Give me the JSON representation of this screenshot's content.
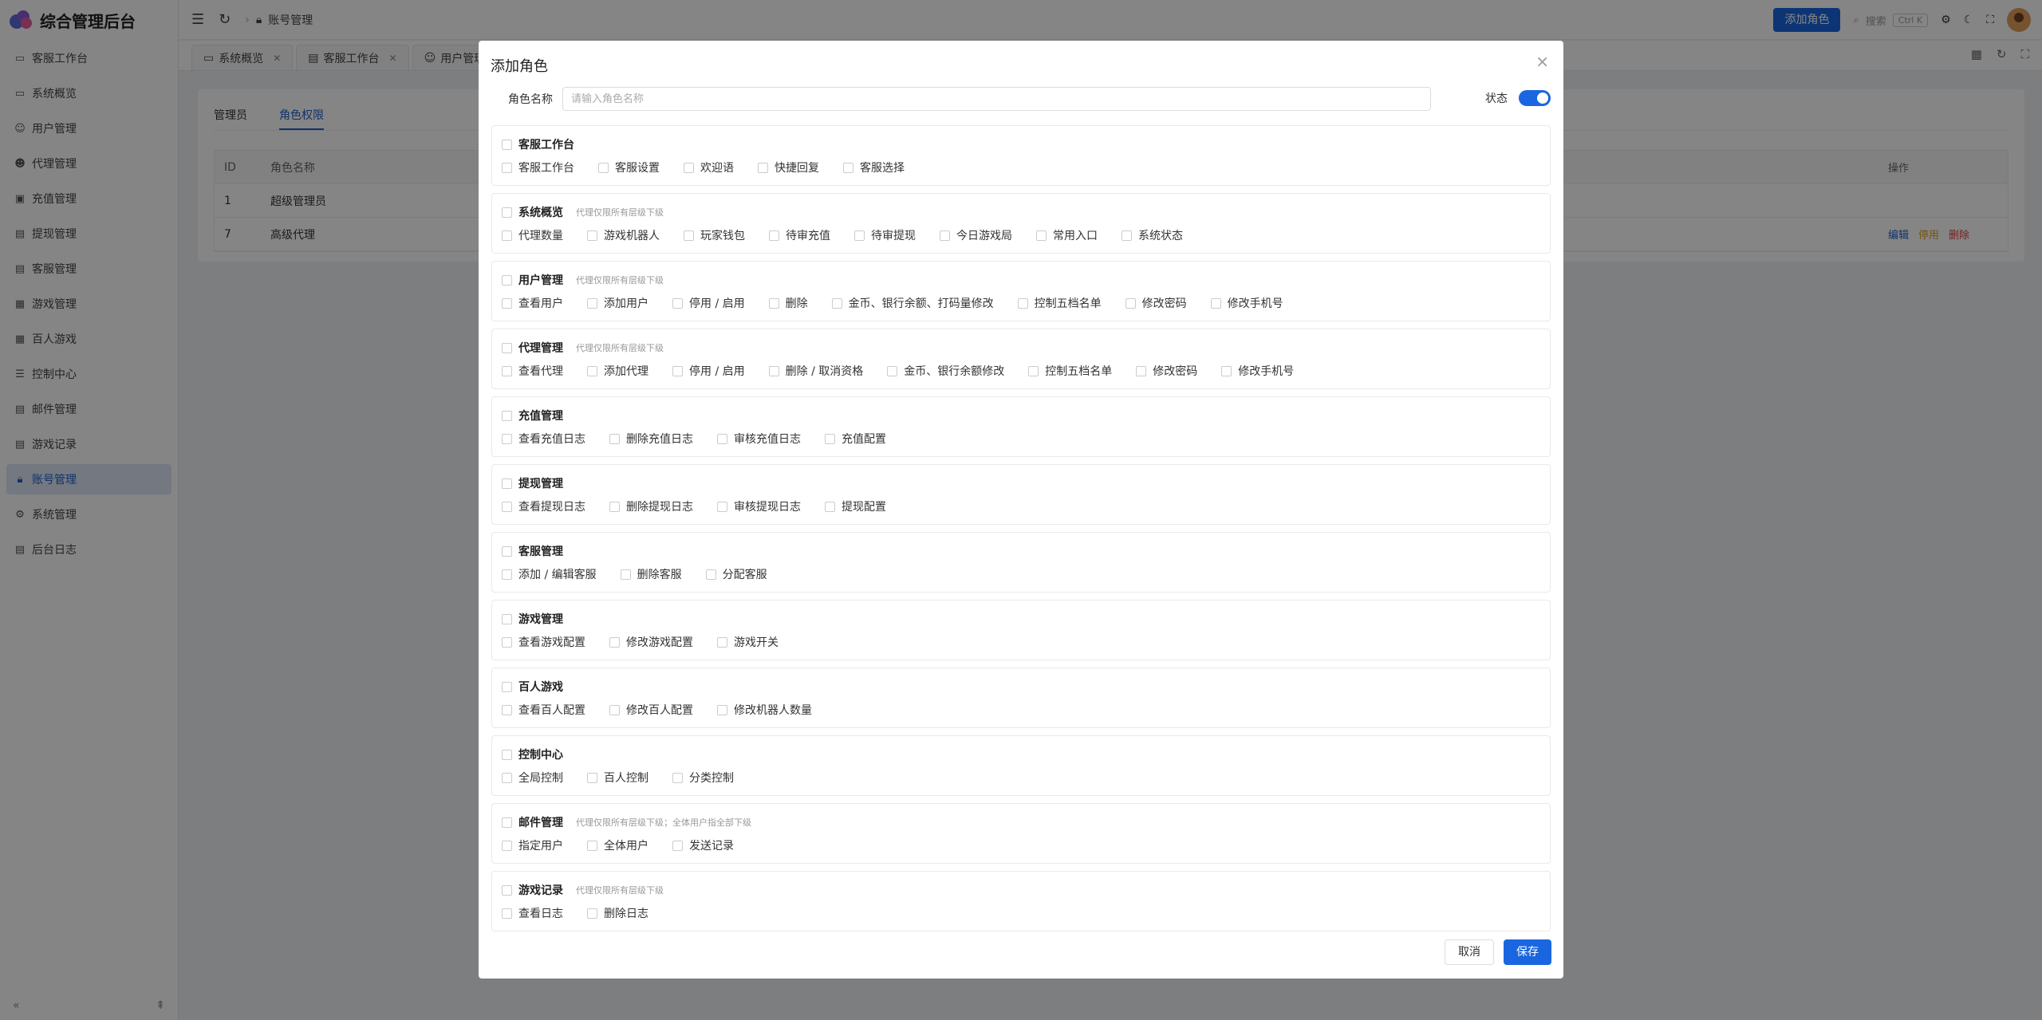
{
  "app": {
    "title": "综合管理后台"
  },
  "sidebar": {
    "items": [
      {
        "label": "客服工作台",
        "icon": "monitor-icon"
      },
      {
        "label": "系统概览",
        "icon": "monitor-icon"
      },
      {
        "label": "用户管理",
        "icon": "user-icon"
      },
      {
        "label": "代理管理",
        "icon": "user-solid-icon"
      },
      {
        "label": "充值管理",
        "icon": "wallet-icon"
      },
      {
        "label": "提现管理",
        "icon": "card-icon"
      },
      {
        "label": "客服管理",
        "icon": "document-icon"
      },
      {
        "label": "游戏管理",
        "icon": "grid-icon"
      },
      {
        "label": "百人游戏",
        "icon": "grid-icon"
      },
      {
        "label": "控制中心",
        "icon": "sliders-icon"
      },
      {
        "label": "邮件管理",
        "icon": "document-icon"
      },
      {
        "label": "游戏记录",
        "icon": "document-icon"
      },
      {
        "label": "账号管理",
        "icon": "lock-icon",
        "active": true
      },
      {
        "label": "系统管理",
        "icon": "gear-icon"
      },
      {
        "label": "后台日志",
        "icon": "document-icon"
      }
    ]
  },
  "topbar": {
    "breadcrumb": "账号管理",
    "add_role": "添加角色",
    "search_label": "搜索",
    "search_shortcut": "Ctrl K"
  },
  "tabs": [
    {
      "label": "系统概览"
    },
    {
      "label": "客服工作台"
    },
    {
      "label": "用户管理"
    }
  ],
  "page": {
    "subtabs": [
      "管理员",
      "角色权限"
    ],
    "table": {
      "headers": {
        "id": "ID",
        "name": "角色名称",
        "op": "操作"
      },
      "rows": [
        {
          "id": "1",
          "name": "超级管理员"
        },
        {
          "id": "7",
          "name": "高级代理"
        }
      ],
      "ops": {
        "edit": "编辑",
        "disable": "停用",
        "delete": "删除"
      }
    }
  },
  "modal": {
    "title": "添加角色",
    "role_label": "角色名称",
    "role_placeholder": "请输入角色名称",
    "status_label": "状态",
    "cancel": "取消",
    "save": "保存",
    "groups": [
      {
        "title": "客服工作台",
        "note": "",
        "items": [
          "客服工作台",
          "客服设置",
          "欢迎语",
          "快捷回复",
          "客服选择"
        ]
      },
      {
        "title": "系统概览",
        "note": "代理仅限所有层级下级",
        "items": [
          "代理数量",
          "游戏机器人",
          "玩家钱包",
          "待审充值",
          "待审提现",
          "今日游戏局",
          "常用入口",
          "系统状态"
        ]
      },
      {
        "title": "用户管理",
        "note": "代理仅限所有层级下级",
        "items": [
          "查看用户",
          "添加用户",
          "停用 / 启用",
          "删除",
          "金币、银行余额、打码量修改",
          "控制五档名单",
          "修改密码",
          "修改手机号"
        ]
      },
      {
        "title": "代理管理",
        "note": "代理仅限所有层级下级",
        "items": [
          "查看代理",
          "添加代理",
          "停用 / 启用",
          "删除 / 取消资格",
          "金币、银行余额修改",
          "控制五档名单",
          "修改密码",
          "修改手机号"
        ]
      },
      {
        "title": "充值管理",
        "note": "",
        "items": [
          "查看充值日志",
          "删除充值日志",
          "审核充值日志",
          "充值配置"
        ]
      },
      {
        "title": "提现管理",
        "note": "",
        "items": [
          "查看提现日志",
          "删除提现日志",
          "审核提现日志",
          "提现配置"
        ]
      },
      {
        "title": "客服管理",
        "note": "",
        "items": [
          "添加 / 编辑客服",
          "删除客服",
          "分配客服"
        ]
      },
      {
        "title": "游戏管理",
        "note": "",
        "items": [
          "查看游戏配置",
          "修改游戏配置",
          "游戏开关"
        ]
      },
      {
        "title": "百人游戏",
        "note": "",
        "items": [
          "查看百人配置",
          "修改百人配置",
          "修改机器人数量"
        ]
      },
      {
        "title": "控制中心",
        "note": "",
        "items": [
          "全局控制",
          "百人控制",
          "分类控制"
        ]
      },
      {
        "title": "邮件管理",
        "note": "代理仅限所有层级下级；全体用户指全部下级",
        "items": [
          "指定用户",
          "全体用户",
          "发送记录"
        ]
      },
      {
        "title": "游戏记录",
        "note": "代理仅限所有层级下级",
        "items": [
          "查看日志",
          "删除日志"
        ]
      }
    ]
  }
}
